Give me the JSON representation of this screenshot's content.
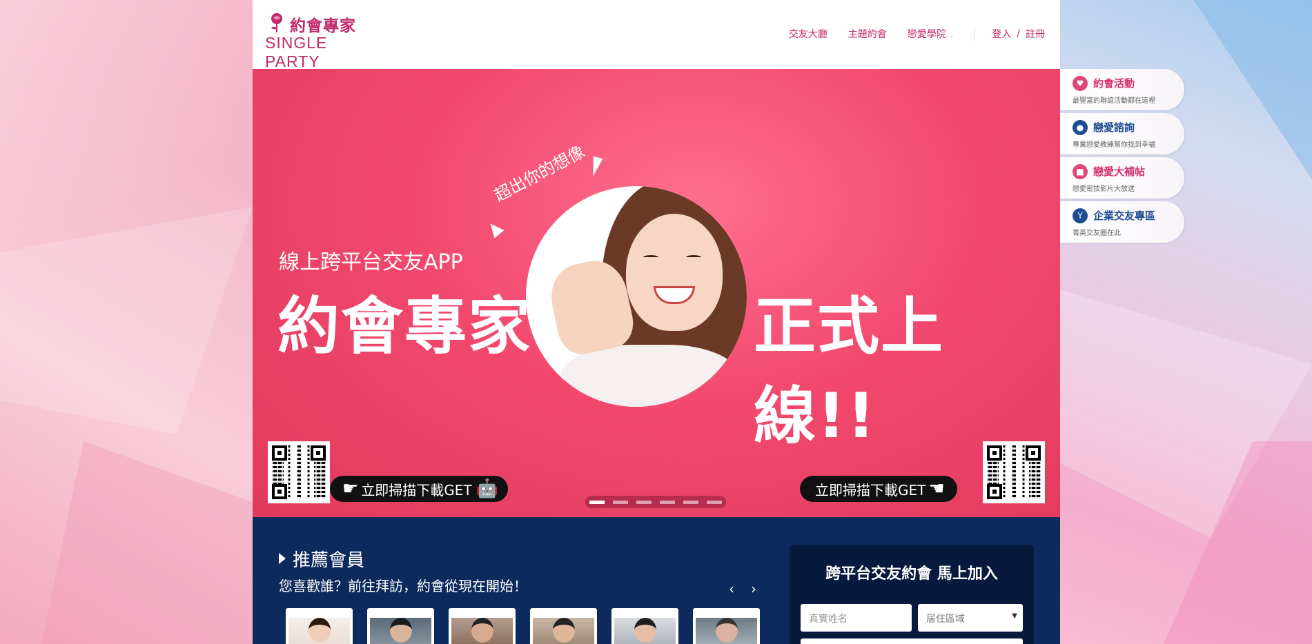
{
  "header": {
    "logo_cn": "約會專家",
    "logo_en": "SINGLE PARTY",
    "nav": [
      {
        "label": "交友大廳"
      },
      {
        "label": "主題約會"
      },
      {
        "label": "戀愛學院"
      }
    ],
    "login": "登入",
    "slash": "/",
    "register": "註冊"
  },
  "banner": {
    "bubble": "超出你的想像",
    "subtitle": "線上跨平台交友APP",
    "headline_left": "約會專家",
    "headline_right": "正式上線!!",
    "android_label": "立即掃描下載GET",
    "ios_label": "立即掃描下載GET",
    "slide_count": 6,
    "active_slide": 1
  },
  "side_tabs": [
    {
      "title": "約會活動",
      "subtitle": "最豐富的聯誼活動都在這裡",
      "icon": "heart-icon",
      "color": "#e0457b"
    },
    {
      "title": "戀愛諮詢",
      "subtitle": "專業戀愛教練幫你找到幸福",
      "icon": "chat-icon",
      "color": "#1e4c93"
    },
    {
      "title": "戀愛大補帖",
      "subtitle": "戀愛密技影片大放送",
      "icon": "video-icon",
      "color": "#e0457b"
    },
    {
      "title": "企業交友專區",
      "subtitle": "菁英交友圈在此",
      "icon": "cocktail-icon",
      "color": "#1e4c93"
    }
  ],
  "recommend": {
    "heading": "推薦會員",
    "description": "您喜歡誰？前往拜訪，約會從現在開始！",
    "prev": "‹",
    "next": "›"
  },
  "join": {
    "title": "跨平台交友約會 馬上加入",
    "name_placeholder": "真實姓名",
    "region_selected": "居住區域"
  }
}
